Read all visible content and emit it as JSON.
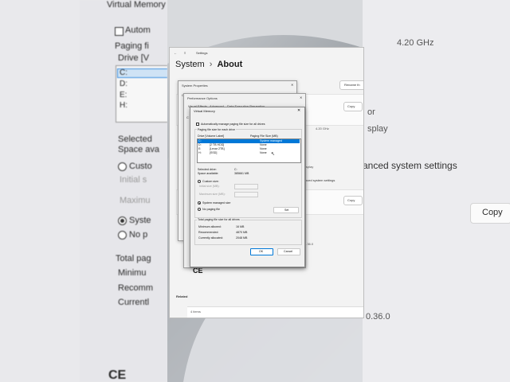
{
  "background_left": {
    "title": "Virtual Memory",
    "auto_label": "Autom",
    "paging_label": "Paging fi",
    "drive_label": "Drive  [V",
    "drives": [
      "C:",
      "D:",
      "E:",
      "H:"
    ],
    "selected_label": "Selected",
    "space_label": "Space ava",
    "custom_label": "Custo",
    "initial_label": "Initial s",
    "maximum_label": "Maximu",
    "system_label": "Syste",
    "nopaging_label": "No p",
    "total_label": "Total pag",
    "min_label": "Minimu",
    "recom_label": "Recomm",
    "current_label": "Currentl",
    "ce": "CE"
  },
  "background_right": {
    "ghz": "4.20 GHz",
    "r1": "or",
    "r2": "splay",
    "advanced": "anced system settings",
    "copy": "Copy",
    "version": "0.36.0"
  },
  "settings": {
    "app_title": "Settings",
    "breadcrumb_parent": "System",
    "breadcrumb_sep": "›",
    "breadcrumb_current": "About",
    "rename_button": "Rename th",
    "copy_button_1": "Copy",
    "copy_button_2": "Copy",
    "ghz": "4.20 GHz",
    "display_text": "isplay",
    "advanced_link": "nced system settings",
    "version": "9.36.0",
    "ce_mark": "CE",
    "related": "Related",
    "items_count": "4 items"
  },
  "system_properties": {
    "title": "System Properties",
    "tab_c": "C"
  },
  "performance_options": {
    "title": "Performance Options",
    "tabs": [
      "Visual Effects",
      "Advanced",
      "Data Execution Prevention"
    ],
    "side_c": "C"
  },
  "virtual_memory": {
    "title": "Virtual Memory",
    "auto_manage_label": "Automatically manage paging file size for all drives",
    "auto_manage_checked": false,
    "group_label": "Paging file size for each drive",
    "col_drive": "Drive  [Volume Label]",
    "col_size": "Paging File Size (MB)",
    "drives": [
      {
        "drive": "C:",
        "label": "",
        "size": "System managed",
        "selected": true
      },
      {
        "drive": "D:",
        "label": "[2 TB HDD]",
        "size": "None",
        "selected": false
      },
      {
        "drive": "E:",
        "label": "[Lexar 2TB]",
        "size": "None",
        "selected": false
      },
      {
        "drive": "H:",
        "label": "[SSD]",
        "size": "None",
        "selected": false
      }
    ],
    "selected_drive_label": "Selected drive:",
    "selected_drive_value": "C:",
    "space_available_label": "Space available:",
    "space_available_value": "385661 MB",
    "custom_size_label": "Custom size:",
    "initial_size_label": "Initial size (MB):",
    "maximum_size_label": "Maximum size (MB):",
    "system_managed_label": "System managed size",
    "no_paging_label": "No paging file",
    "selected_option": "system_managed",
    "set_button": "Set",
    "total_group_label": "Total paging file size for all drives",
    "minimum_allowed_label": "Minimum allowed:",
    "minimum_allowed_value": "16 MB",
    "recommended_label": "Recommended:",
    "recommended_value": "4870 MB",
    "currently_allocated_label": "Currently allocated:",
    "currently_allocated_value": "2048 MB",
    "ok_button": "OK",
    "cancel_button": "Cancel",
    "close_icon": "close-icon"
  },
  "perf_buttons": {
    "ok": "OK",
    "cancel": "Cancel",
    "apply": "Apply"
  },
  "colors": {
    "selection": "#0078d7",
    "accent_blue": "#0063b1"
  }
}
